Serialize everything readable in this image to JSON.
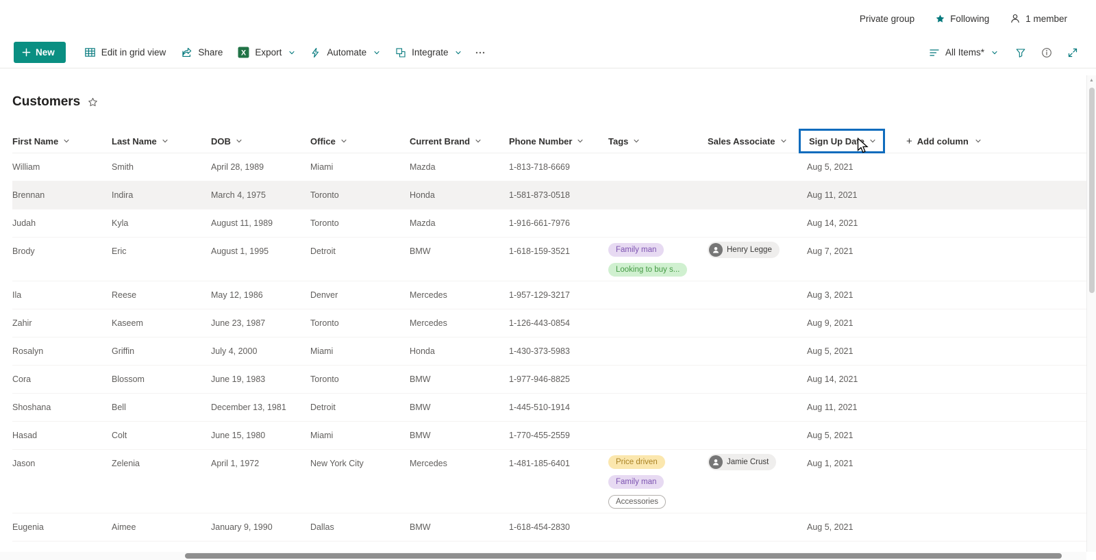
{
  "top_bar": {
    "private_group": "Private group",
    "following": "Following",
    "members": "1 member"
  },
  "command_bar": {
    "new": "New",
    "edit_grid": "Edit in grid view",
    "share": "Share",
    "export": "Export",
    "automate": "Automate",
    "integrate": "Integrate",
    "view_selector": "All Items*"
  },
  "page": {
    "title": "Customers"
  },
  "table": {
    "columns": [
      {
        "label": "First Name"
      },
      {
        "label": "Last Name"
      },
      {
        "label": "DOB"
      },
      {
        "label": "Office"
      },
      {
        "label": "Current Brand"
      },
      {
        "label": "Phone Number"
      },
      {
        "label": "Tags"
      },
      {
        "label": "Sales Associate"
      },
      {
        "label": "Sign Up Date",
        "selected": true
      }
    ],
    "add_column_label": "Add column",
    "rows": [
      {
        "first": "William",
        "last": "Smith",
        "dob": "April 28, 1989",
        "office": "Miami",
        "brand": "Mazda",
        "phone": "1-813-718-6669",
        "tags": [],
        "associate": null,
        "signup": "Aug 5, 2021"
      },
      {
        "first": "Brennan",
        "last": "Indira",
        "dob": "March 4, 1975",
        "office": "Toronto",
        "brand": "Honda",
        "phone": "1-581-873-0518",
        "tags": [],
        "associate": null,
        "signup": "Aug 11, 2021",
        "highlighted": true
      },
      {
        "first": "Judah",
        "last": "Kyla",
        "dob": "August 11, 1989",
        "office": "Toronto",
        "brand": "Mazda",
        "phone": "1-916-661-7976",
        "tags": [],
        "associate": null,
        "signup": "Aug 14, 2021"
      },
      {
        "first": "Brody",
        "last": "Eric",
        "dob": "August 1, 1995",
        "office": "Detroit",
        "brand": "BMW",
        "phone": "1-618-159-3521",
        "tags": [
          {
            "label": "Family man",
            "color": "purple"
          },
          {
            "label": "Looking to buy s...",
            "color": "green"
          }
        ],
        "associate": "Henry Legge",
        "signup": "Aug 7, 2021"
      },
      {
        "first": "Ila",
        "last": "Reese",
        "dob": "May 12, 1986",
        "office": "Denver",
        "brand": "Mercedes",
        "phone": "1-957-129-3217",
        "tags": [],
        "associate": null,
        "signup": "Aug 3, 2021"
      },
      {
        "first": "Zahir",
        "last": "Kaseem",
        "dob": "June 23, 1987",
        "office": "Toronto",
        "brand": "Mercedes",
        "phone": "1-126-443-0854",
        "tags": [],
        "associate": null,
        "signup": "Aug 9, 2021"
      },
      {
        "first": "Rosalyn",
        "last": "Griffin",
        "dob": "July 4, 2000",
        "office": "Miami",
        "brand": "Honda",
        "phone": "1-430-373-5983",
        "tags": [],
        "associate": null,
        "signup": "Aug 5, 2021"
      },
      {
        "first": "Cora",
        "last": "Blossom",
        "dob": "June 19, 1983",
        "office": "Toronto",
        "brand": "BMW",
        "phone": "1-977-946-8825",
        "tags": [],
        "associate": null,
        "signup": "Aug 14, 2021"
      },
      {
        "first": "Shoshana",
        "last": "Bell",
        "dob": "December 13, 1981",
        "office": "Detroit",
        "brand": "BMW",
        "phone": "1-445-510-1914",
        "tags": [],
        "associate": null,
        "signup": "Aug 11, 2021"
      },
      {
        "first": "Hasad",
        "last": "Colt",
        "dob": "June 15, 1980",
        "office": "Miami",
        "brand": "BMW",
        "phone": "1-770-455-2559",
        "tags": [],
        "associate": null,
        "signup": "Aug 5, 2021"
      },
      {
        "first": "Jason",
        "last": "Zelenia",
        "dob": "April 1, 1972",
        "office": "New York City",
        "brand": "Mercedes",
        "phone": "1-481-185-6401",
        "tags": [
          {
            "label": "Price driven",
            "color": "yellow"
          },
          {
            "label": "Family man",
            "color": "purple"
          },
          {
            "label": "Accessories",
            "color": "outline"
          }
        ],
        "associate": "Jamie Crust",
        "signup": "Aug 1, 2021"
      },
      {
        "first": "Eugenia",
        "last": "Aimee",
        "dob": "January 9, 1990",
        "office": "Dallas",
        "brand": "BMW",
        "phone": "1-618-454-2830",
        "tags": [],
        "associate": null,
        "signup": "Aug 5, 2021"
      }
    ]
  },
  "colors": {
    "accent_teal": "#03787c",
    "new_button_bg": "#0a8f82",
    "selection_blue": "#0f6cbd",
    "excel_green": "#217346",
    "row_highlight": "#f3f2f1",
    "tag_purple_bg": "#e7daf2",
    "tag_green_bg": "#d0f0d0",
    "tag_yellow_bg": "#fbe7ae"
  }
}
